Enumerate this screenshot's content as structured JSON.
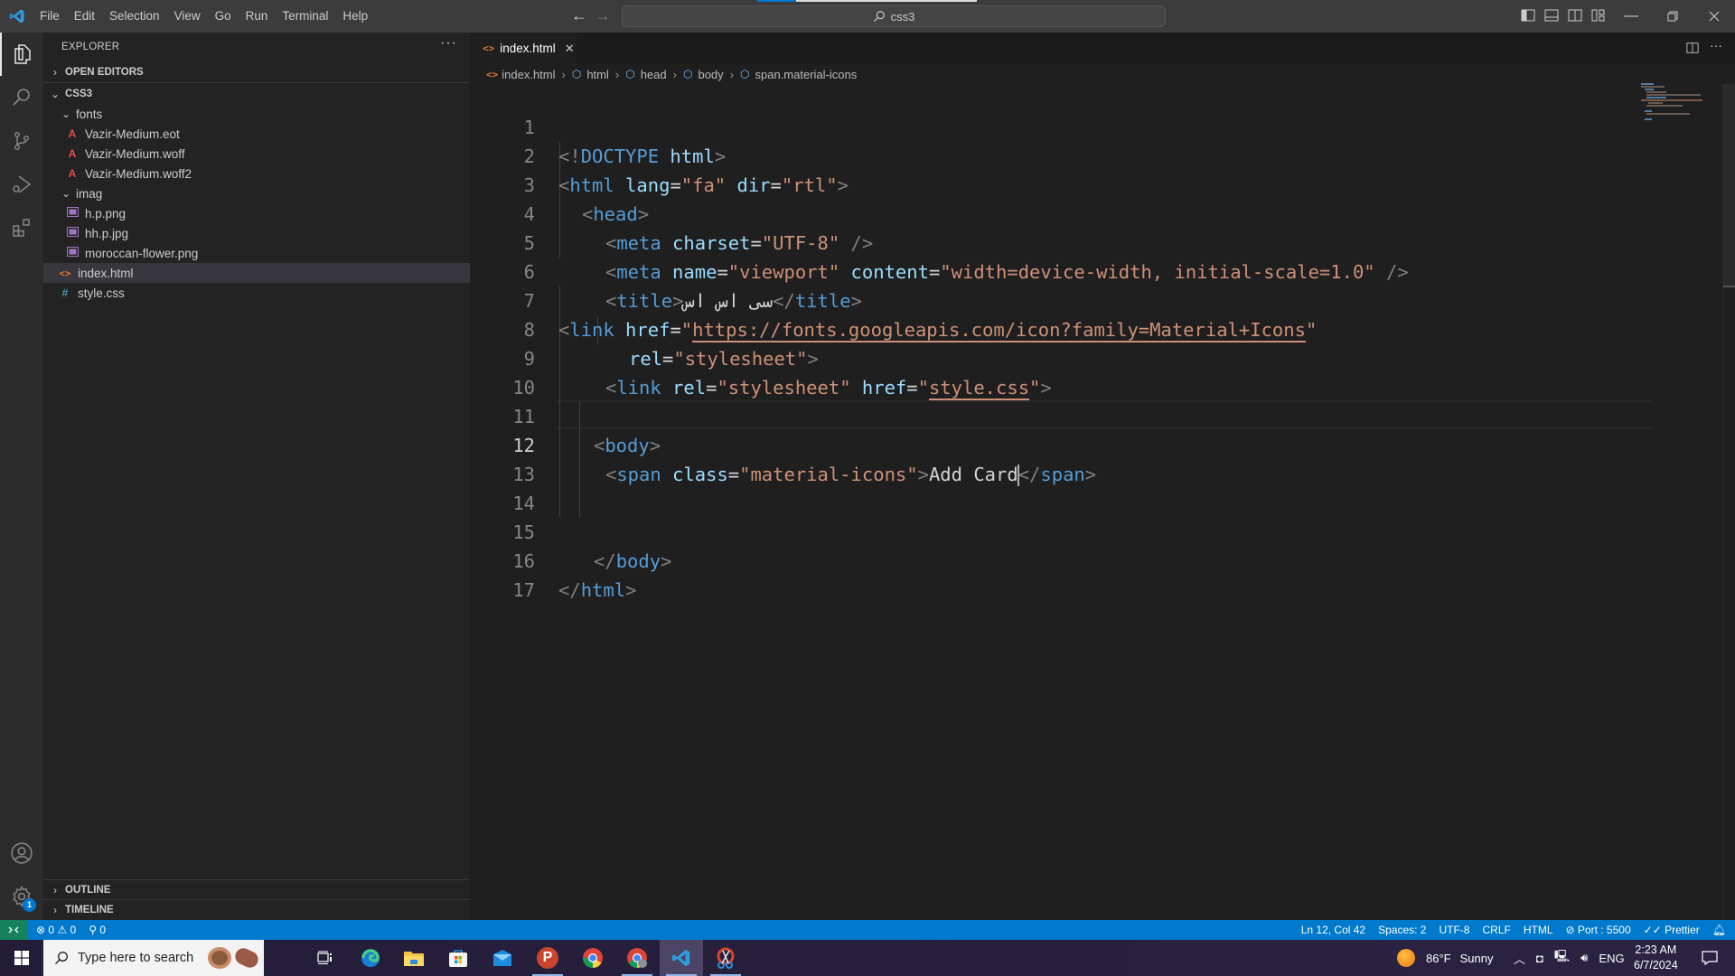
{
  "titlebar": {
    "menu": [
      "File",
      "Edit",
      "Selection",
      "View",
      "Go",
      "Run",
      "Terminal",
      "Help"
    ],
    "command_center": "css3"
  },
  "sidebar": {
    "title": "EXPLORER",
    "more": "···",
    "open_editors": "OPEN EDITORS",
    "project": "CSS3",
    "tree": [
      {
        "label": "fonts",
        "type": "folder",
        "expanded": true
      },
      {
        "label": "Vazir-Medium.eot",
        "type": "font"
      },
      {
        "label": "Vazir-Medium.woff",
        "type": "font"
      },
      {
        "label": "Vazir-Medium.woff2",
        "type": "font"
      },
      {
        "label": "imag",
        "type": "folder",
        "expanded": true
      },
      {
        "label": "h.p.png",
        "type": "image"
      },
      {
        "label": "hh.p.jpg",
        "type": "image"
      },
      {
        "label": "moroccan-flower.png",
        "type": "image"
      },
      {
        "label": "index.html",
        "type": "html",
        "selected": true
      },
      {
        "label": "style.css",
        "type": "css"
      }
    ],
    "outline": "OUTLINE",
    "timeline": "TIMELINE"
  },
  "editor": {
    "tab": {
      "label": "index.html",
      "close": "✕"
    },
    "breadcrumb": [
      "index.html",
      "html",
      "head",
      "body",
      "span.material-icons"
    ],
    "current_line": 12,
    "line_numbers": [
      "1",
      "2",
      "3",
      "4",
      "5",
      "6",
      "7",
      "8",
      "9",
      "10",
      "11",
      "12",
      "13",
      "14",
      "15",
      "16",
      "17"
    ],
    "lines": {
      "l1": {
        "a": "<!",
        "b": "DOCTYPE",
        "c": " html",
        "d": ">"
      },
      "l2": {
        "a": "<",
        "b": "html",
        "c": " lang",
        "d": "=",
        "e": "\"fa\"",
        "f": " dir",
        "g": "=",
        "h": "\"rtl\"",
        "i": ">"
      },
      "l3": {
        "a": "<",
        "b": "head",
        "c": ">"
      },
      "l4": {
        "a": "<",
        "b": "meta",
        "c": " charset",
        "d": "=",
        "e": "\"UTF-8\"",
        "f": " />"
      },
      "l5": {
        "a": "<",
        "b": "meta",
        "c": " name",
        "d": "=",
        "e": "\"viewport\"",
        "f": " content",
        "g": "=",
        "h": "\"width=device-width, initial-scale=1.0\"",
        "i": " />"
      },
      "l6": {
        "a": "<",
        "b": "title",
        "c": ">",
        "d": "سی اس اس",
        "e": "</",
        "f": "title",
        "g": ">"
      },
      "l7": {
        "a": "<",
        "b": "link",
        "c": " href",
        "d": "=",
        "e": "\"",
        "f": "https://fonts.googleapis.com/icon?family=Material+Icons",
        "g": "\""
      },
      "l8": {
        "a": "rel",
        "b": "=",
        "c": "\"stylesheet\"",
        "d": ">"
      },
      "l9": {
        "a": "<",
        "b": "link",
        "c": " rel",
        "d": "=",
        "e": "\"stylesheet\"",
        "f": " href",
        "g": "=",
        "h": "\"",
        "i": "style.css",
        "j": "\"",
        "k": ">"
      },
      "l11": {
        "a": "<",
        "b": "body",
        "c": ">"
      },
      "l12": {
        "a": "<",
        "b": "span",
        "c": " class",
        "d": "=",
        "e": "\"material-icons\"",
        "f": ">",
        "g": "Add Card",
        "h": "</",
        "i": "span",
        "j": ">"
      },
      "l15": {
        "a": "</",
        "b": "body",
        "c": ">"
      },
      "l16": {
        "a": "</",
        "b": "html",
        "c": ">"
      }
    }
  },
  "statusbar": {
    "errors": "0",
    "warnings": "0",
    "ports": "0",
    "position": "Ln 12, Col 42",
    "spaces": "Spaces: 2",
    "encoding": "UTF-8",
    "eol": "CRLF",
    "language": "HTML",
    "port": "Port : 5500",
    "prettier": "Prettier"
  },
  "taskbar": {
    "search_placeholder": "Type here to search",
    "weather_temp": "86°F",
    "weather_desc": "Sunny",
    "language": "ENG",
    "time": "2:23 AM",
    "date": "6/7/2024"
  },
  "activity": {
    "settings_badge": "1"
  },
  "colors": {
    "accent": "#007acc",
    "remote": "#16825d",
    "tag": "#569cd6",
    "attr": "#9cdcfe",
    "string": "#ce9178"
  }
}
